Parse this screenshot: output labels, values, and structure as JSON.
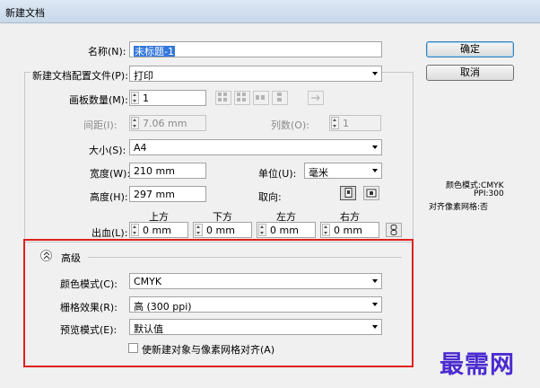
{
  "window": {
    "title": "新建文档"
  },
  "form": {
    "name_label": "名称(N):",
    "name_value": "未标题-1",
    "profile_label": "新建文档配置文件(P):",
    "profile_value": "打印",
    "artboards_label": "画板数量(M):",
    "artboards_value": "1",
    "spacing_label": "间距(I):",
    "spacing_value": "7.06 mm",
    "columns_label": "列数(O):",
    "columns_value": "1",
    "size_label": "大小(S):",
    "size_value": "A4",
    "width_label": "宽度(W):",
    "width_value": "210 mm",
    "unit_label": "单位(U):",
    "unit_value": "毫米",
    "height_label": "高度(H):",
    "height_value": "297 mm",
    "orientation_label": "取向:",
    "bleed_label": "出血(L):",
    "bleed_top_label": "上方",
    "bleed_top_value": "0 mm",
    "bleed_bottom_label": "下方",
    "bleed_bottom_value": "0 mm",
    "bleed_left_label": "左方",
    "bleed_left_value": "0 mm",
    "bleed_right_label": "右方",
    "bleed_right_value": "0 mm"
  },
  "advanced": {
    "section_label": "高级",
    "color_mode_label": "颜色模式(C):",
    "color_mode_value": "CMYK",
    "raster_label": "栅格效果(R):",
    "raster_value": "高 (300 ppi)",
    "preview_label": "预览模式(E):",
    "preview_value": "默认值",
    "align_label": "使新建对象与像素网格对齐(A)",
    "align_checked": false
  },
  "buttons": {
    "ok": "确定",
    "cancel": "取消"
  },
  "summary": {
    "color_mode": "颜色模式:CMYK",
    "ppi": "PPI:300",
    "pixel_grid": "对齐像素网格:否"
  },
  "watermark": {
    "text": "最需网"
  },
  "colors": {
    "highlight_border": "#e02020",
    "watermark": "#4b2bd0",
    "selection": "#3377dd"
  }
}
